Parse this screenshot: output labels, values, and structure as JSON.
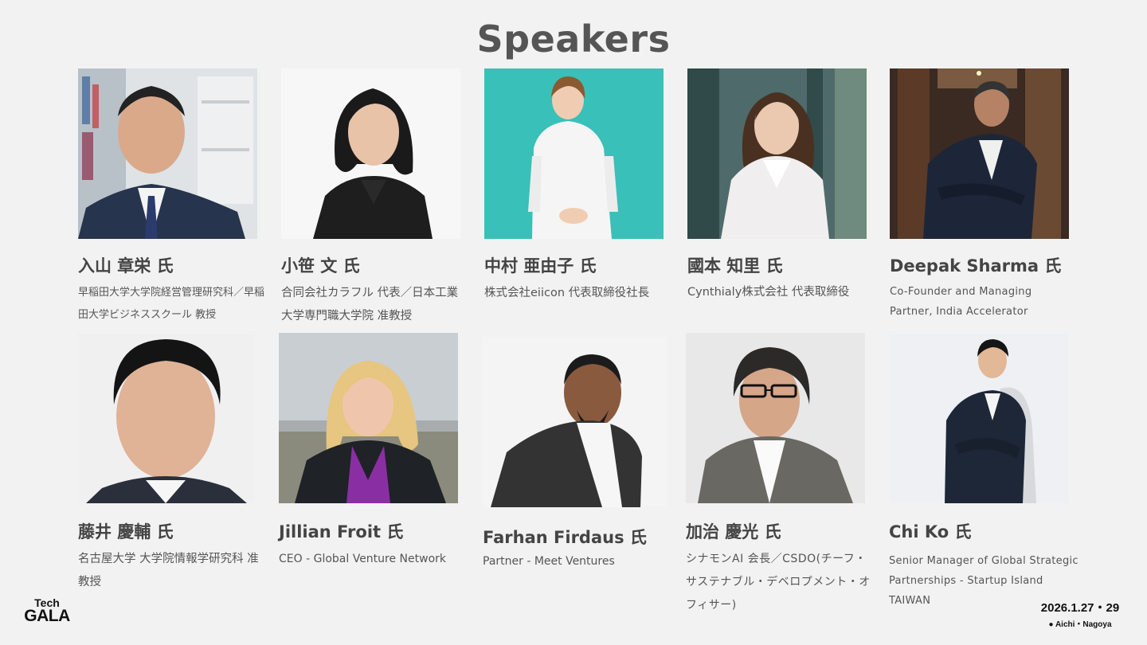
{
  "title": "Speakers",
  "speakers": [
    {
      "name": "入山 章栄 氏",
      "role": "早稲田大学大学院経営管理研究科／早稲田大学ビジネススクール 教授"
    },
    {
      "name": "小笹 文 氏",
      "role": "合同会社カラフル 代表／日本工業大学専門職大学院 准教授"
    },
    {
      "name": "中村 亜由子 氏",
      "role": "株式会社eiicon 代表取締役社長"
    },
    {
      "name": "國本 知里 氏",
      "role": "Cynthialy株式会社 代表取締役"
    },
    {
      "name": "Deepak Sharma 氏",
      "role": "Co-Founder and Managing Partner, India Accelerator"
    },
    {
      "name": "藤井 慶輔 氏",
      "role": "名古屋大学 大学院情報学研究科 准教授"
    },
    {
      "name": "Jillian Froit 氏",
      "role": "CEO - Global Venture Network"
    },
    {
      "name": "Farhan Firdaus 氏",
      "role": "Partner - Meet Ventures"
    },
    {
      "name": "加治 慶光 氏",
      "role": "シナモンAI 会長／CSDO(チーフ・サステナブル・デベロプメント・オフィサー)"
    },
    {
      "name": "Chi Ko 氏",
      "role": "Senior Manager of Global Strategic Partnerships - Startup Island TAIWAN"
    }
  ],
  "footer": {
    "logo_top": "Tech",
    "logo_bottom": "GALA",
    "dates": "2026.1.27・29",
    "location": "Aichi・Nagoya"
  }
}
